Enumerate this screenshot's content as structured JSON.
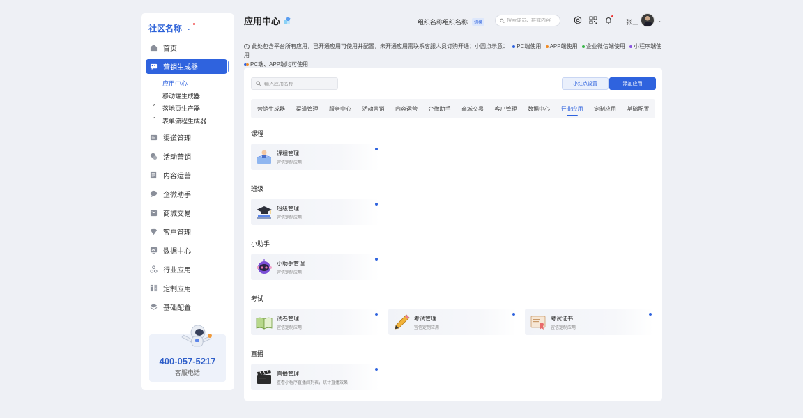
{
  "sidebar": {
    "brand": "社区名称",
    "items": [
      {
        "label": "首页",
        "icon": "home-icon"
      },
      {
        "label": "营销生成器",
        "icon": "message-icon",
        "active": true
      },
      {
        "label": "渠道管理",
        "icon": "channel-icon"
      },
      {
        "label": "活动营销",
        "icon": "activity-icon"
      },
      {
        "label": "内容运营",
        "icon": "content-icon"
      },
      {
        "label": "企微助手",
        "icon": "chat-bubble-icon"
      },
      {
        "label": "商城交易",
        "icon": "mall-icon"
      },
      {
        "label": "客户管理",
        "icon": "customer-icon"
      },
      {
        "label": "数据中心",
        "icon": "data-icon"
      },
      {
        "label": "行业应用",
        "icon": "industry-icon"
      },
      {
        "label": "定制应用",
        "icon": "custom-icon"
      },
      {
        "label": "基础配置",
        "icon": "settings-stack-icon"
      }
    ],
    "subitems": [
      {
        "label": "应用中心",
        "active": true
      },
      {
        "label": "移动端生成器"
      },
      {
        "label": "落地页生产器"
      },
      {
        "label": "表单流程生成器"
      }
    ],
    "contact": {
      "phone": "400-057-5217",
      "label": "客服电话"
    }
  },
  "header": {
    "title": "应用中心",
    "org_name": "组织名称组织名称",
    "switch_label": "切换",
    "search_placeholder": "搜索成员、群或内容",
    "user_name": "张三"
  },
  "notice": {
    "text": "此处包含平台所有应用，已开通应用可使用并配置，未开通应用需联系客服人员订购开通；小圆点示意：",
    "legend": [
      {
        "label": "PC端使用",
        "color": "#2f63de"
      },
      {
        "label": "APP端使用",
        "color": "#f08a24"
      },
      {
        "label": "企业微信端使用",
        "color": "#3bb64a"
      },
      {
        "label": "小程序端使用",
        "color": "#8a55e0"
      },
      {
        "label": "PC端、APP端均可使用",
        "color": "#2f63de",
        "color2": "#f08a24"
      }
    ]
  },
  "main": {
    "search_placeholder": "输入应用名称",
    "btn_secondary": "小红点设置",
    "btn_primary": "添加应用",
    "tabs": [
      "营销生成器",
      "渠道管理",
      "服务中心",
      "活动营销",
      "内容运营",
      "企微助手",
      "商城交易",
      "客户管理",
      "数据中心",
      "行业应用",
      "定制应用",
      "基础配置"
    ],
    "active_tab": "行业应用",
    "sections": [
      {
        "title": "课程",
        "apps": [
          {
            "title": "课程管理",
            "desc": "宜信定制应用",
            "icon": "course-book-icon"
          }
        ]
      },
      {
        "title": "班级",
        "apps": [
          {
            "title": "班级管理",
            "desc": "宜信定制应用",
            "icon": "graduation-cap-icon"
          }
        ]
      },
      {
        "title": "小助手",
        "apps": [
          {
            "title": "小助手管理",
            "desc": "宜信定制应用",
            "icon": "robot-icon"
          }
        ]
      },
      {
        "title": "考试",
        "apps": [
          {
            "title": "试卷管理",
            "desc": "宜信定制应用",
            "icon": "open-book-icon"
          },
          {
            "title": "考试管理",
            "desc": "宜信定制应用",
            "icon": "pencil-icon"
          },
          {
            "title": "考试证书",
            "desc": "宜信定制应用",
            "icon": "certificate-icon"
          }
        ]
      },
      {
        "title": "直播",
        "apps": [
          {
            "title": "直播管理",
            "desc": "查看小程序直播间列表，统计直播效果",
            "icon": "clapperboard-icon"
          }
        ]
      }
    ]
  }
}
